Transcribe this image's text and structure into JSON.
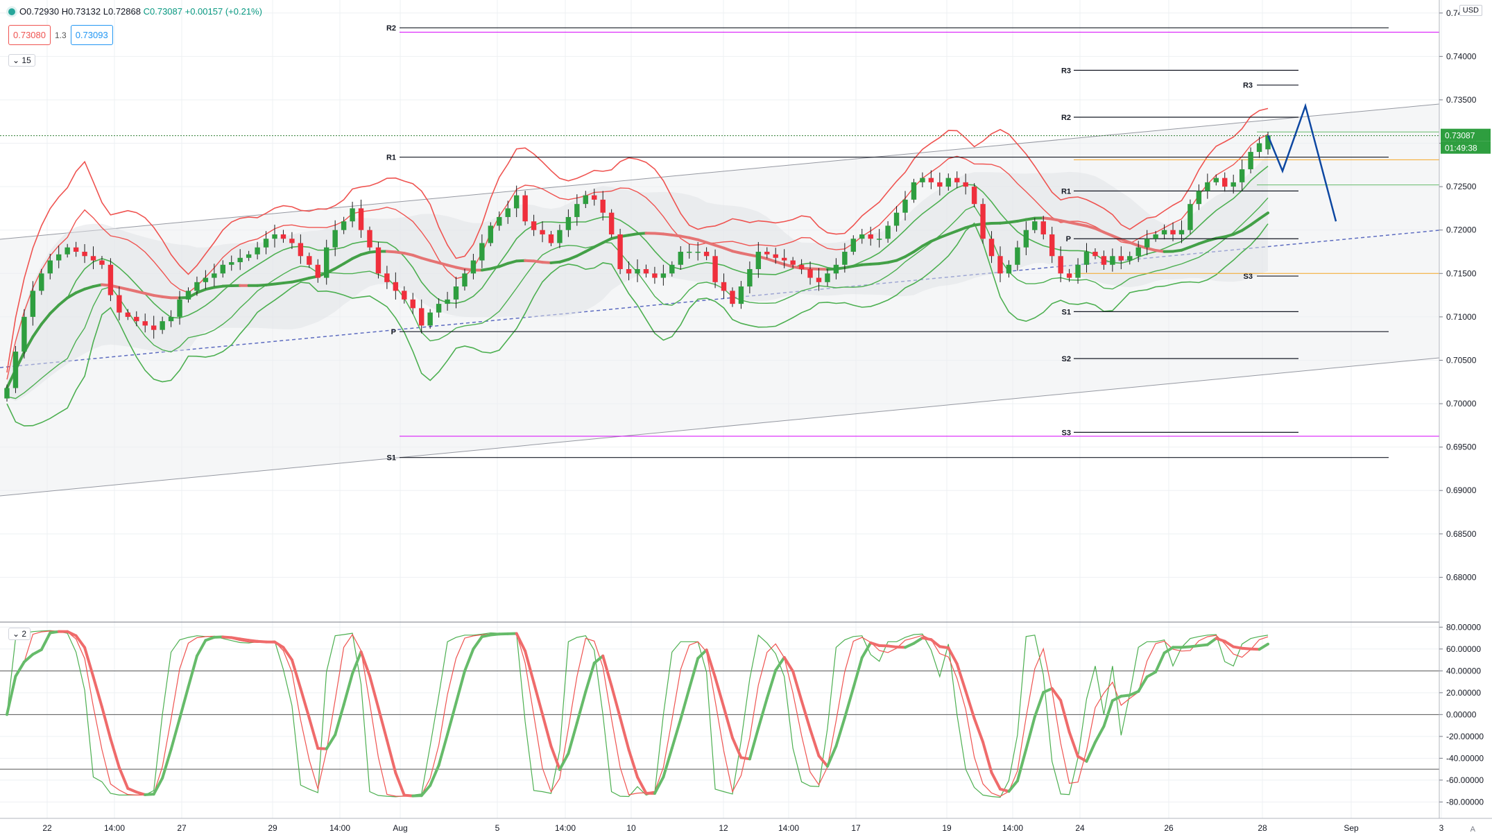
{
  "header": {
    "open_label": "O0.72930",
    "high_label": "H0.73132",
    "low_label": "L0.72868",
    "close_label": "C0.73087",
    "change_label": "+0.00157 (+0.21%)",
    "bid_price": "0.73080",
    "spread": "1.3",
    "ask_price": "0.73093",
    "interval_label": "15",
    "currency": "USD",
    "indicator_pane_label": "2",
    "auto_label": "A"
  },
  "price_axis": {
    "min": 0.675,
    "max": 0.7465,
    "ticks": [
      "0.74500",
      "0.74000",
      "0.73500",
      "0.73000",
      "0.72500",
      "0.72000",
      "0.71500",
      "0.71000",
      "0.70500",
      "0.70000",
      "0.69500",
      "0.69000",
      "0.68500",
      "0.68000"
    ],
    "last_price_tag": "0.73087",
    "countdown_tag": "01:49:38"
  },
  "osc_axis": {
    "min": -95,
    "max": 84,
    "ticks": [
      "80.00000",
      "60.00000",
      "40.00000",
      "20.00000",
      "0.00000",
      "-20.00000",
      "-40.00000",
      "-60.00000",
      "-80.00000"
    ]
  },
  "time_axis": {
    "labels": [
      "22",
      "14:00",
      "27",
      "29",
      "14:00",
      "Aug",
      "5",
      "14:00",
      "10",
      "12",
      "14:00",
      "17",
      "19",
      "14:00",
      "24",
      "26",
      "28",
      "Sep",
      "3"
    ]
  },
  "pivots": {
    "monthly": [
      {
        "label": "R2",
        "value": 0.7433
      },
      {
        "label": "R1",
        "value": 0.7284
      },
      {
        "label": "P",
        "value": 0.7083
      },
      {
        "label": "S1",
        "value": 0.6938
      }
    ],
    "weekly": [
      {
        "label": "R3",
        "value": 0.7384
      },
      {
        "label": "R2",
        "value": 0.733
      },
      {
        "label": "R1",
        "value": 0.7245
      },
      {
        "label": "P",
        "value": 0.719
      },
      {
        "label": "S1",
        "value": 0.7106
      },
      {
        "label": "S2",
        "value": 0.7052
      },
      {
        "label": "S3",
        "value": 0.6967
      }
    ],
    "daily": [
      {
        "label": "R3",
        "value": 0.7367
      },
      {
        "label": "S3",
        "value": 0.7147
      }
    ]
  },
  "colors": {
    "up": "#2e9e3f",
    "down": "#ef2f3c",
    "band_red": "#ef5350",
    "band_green": "#4caf50",
    "channel": "#9598a1",
    "magenta": "#d500f9",
    "orange": "#f5a623",
    "projection": "#0d47a1",
    "teal": "#26a69a",
    "grid": "#eef0f3"
  },
  "chart_data": {
    "type": "candlestick",
    "symbol_pair_quote": "USD",
    "timeframe": "15",
    "last": {
      "open": 0.7293,
      "high": 0.73132,
      "low": 0.72868,
      "close": 0.73087
    },
    "closes": [
      0.7018,
      0.706,
      0.71,
      0.713,
      0.715,
      0.7165,
      0.7172,
      0.718,
      0.7175,
      0.717,
      0.7165,
      0.716,
      0.7125,
      0.7105,
      0.71,
      0.7095,
      0.709,
      0.7085,
      0.7095,
      0.71,
      0.712,
      0.713,
      0.714,
      0.7145,
      0.715,
      0.716,
      0.7163,
      0.7168,
      0.7172,
      0.718,
      0.719,
      0.7195,
      0.719,
      0.7185,
      0.717,
      0.716,
      0.7145,
      0.718,
      0.72,
      0.721,
      0.7225,
      0.72,
      0.718,
      0.715,
      0.714,
      0.713,
      0.712,
      0.711,
      0.709,
      0.7105,
      0.7115,
      0.712,
      0.7135,
      0.715,
      0.7165,
      0.7185,
      0.7205,
      0.7215,
      0.7225,
      0.724,
      0.721,
      0.72,
      0.7195,
      0.7185,
      0.72,
      0.7215,
      0.723,
      0.724,
      0.7235,
      0.722,
      0.7195,
      0.7155,
      0.715,
      0.7155,
      0.715,
      0.7145,
      0.715,
      0.716,
      0.7175,
      0.7175,
      0.7175,
      0.717,
      0.714,
      0.713,
      0.7115,
      0.7135,
      0.7155,
      0.7175,
      0.7172,
      0.7168,
      0.7165,
      0.716,
      0.7155,
      0.7145,
      0.714,
      0.715,
      0.716,
      0.7175,
      0.719,
      0.7195,
      0.719,
      0.719,
      0.7205,
      0.722,
      0.7235,
      0.7255,
      0.726,
      0.7255,
      0.725,
      0.726,
      0.7255,
      0.725,
      0.723,
      0.719,
      0.717,
      0.715,
      0.716,
      0.718,
      0.72,
      0.721,
      0.7195,
      0.717,
      0.715,
      0.7145,
      0.716,
      0.7175,
      0.717,
      0.716,
      0.717,
      0.7165,
      0.717,
      0.718,
      0.719,
      0.7195,
      0.72,
      0.7195,
      0.72,
      0.723,
      0.7245,
      0.7255,
      0.726,
      0.725,
      0.7255,
      0.727,
      0.729,
      0.73,
      0.7309
    ],
    "projection": [
      0.7309,
      0.7268,
      0.7343,
      0.721
    ],
    "oscillator": {
      "lines": [
        "slow (bold green)",
        "signal (red)",
        "fast (green)"
      ],
      "levels": [
        40,
        0,
        -50
      ]
    }
  }
}
